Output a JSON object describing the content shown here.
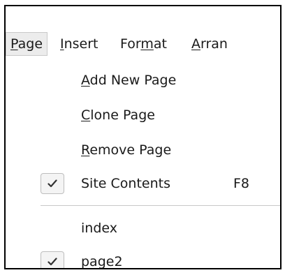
{
  "menubar": {
    "items": [
      {
        "label_pre": "",
        "label_accel": "P",
        "label_post": "age"
      },
      {
        "label_pre": "",
        "label_accel": "I",
        "label_post": "nsert"
      },
      {
        "label_pre": "For",
        "label_accel": "m",
        "label_post": "at"
      },
      {
        "label_pre": "",
        "label_accel": "A",
        "label_post": "rran"
      }
    ]
  },
  "dropdown": {
    "add_new_page": {
      "accel": "A",
      "rest": "dd New Page"
    },
    "clone_page": {
      "accel": "C",
      "rest": "lone Page"
    },
    "remove_page": {
      "accel": "R",
      "rest": "emove Page"
    },
    "site_contents": {
      "label": "Site Contents",
      "shortcut": "F8",
      "checked": true
    },
    "pages": [
      {
        "label": "index",
        "checked": false
      },
      {
        "label": "page2",
        "checked": true
      }
    ]
  },
  "icons": {
    "check": "checkmark-icon"
  }
}
